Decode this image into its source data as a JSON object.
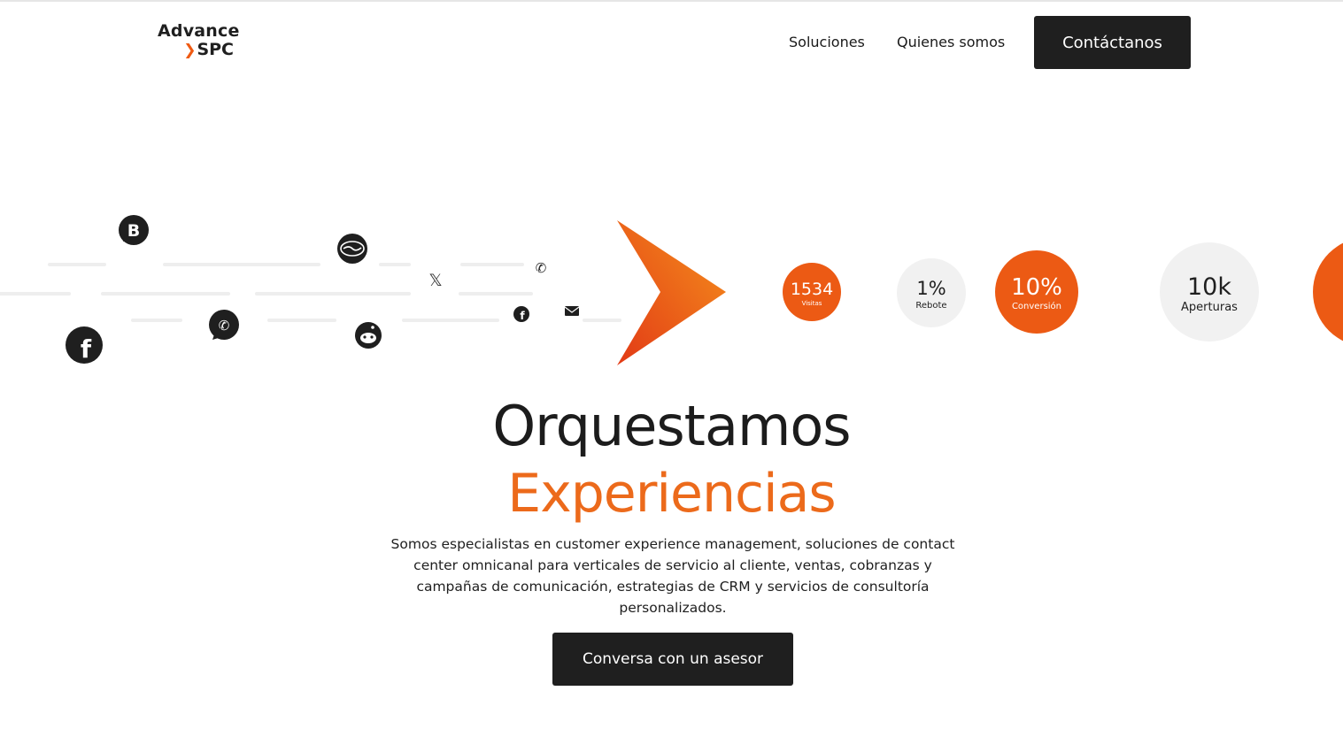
{
  "brand": {
    "line1": "Advance",
    "line2": "SPC",
    "accent": "#ef5a12"
  },
  "nav": {
    "items": [
      {
        "label": "Soluciones"
      },
      {
        "label": "Quienes somos"
      }
    ],
    "cta_label": "Contáctanos"
  },
  "hero": {
    "headline": "Orquestamos",
    "headline_accent": "Experiencias",
    "subtitle": "Somos especialistas en customer experience management, soluciones de contact center omnicanal para verticales de servicio al cliente, ventas, cobranzas y campañas de comunicación, estrategias de CRM y servicios de consultoría personalizados.",
    "cta_label": "Conversa con un asesor",
    "stats": [
      {
        "value": "1534",
        "label": "Visitas"
      },
      {
        "value": "1%",
        "label": "Rebote"
      },
      {
        "value": "10%",
        "label": "Conversión"
      },
      {
        "value": "10k",
        "label": "Aperturas"
      }
    ],
    "channel_icons": [
      "business-b-icon",
      "handshake-icon",
      "x-icon",
      "phone-icon",
      "facebook-icon",
      "whatsapp-icon",
      "reddit-icon",
      "mail-icon"
    ]
  },
  "colors": {
    "orange": "#ec5a14",
    "dark": "#1f1f1f",
    "light_circle": "#f1f1f1"
  }
}
